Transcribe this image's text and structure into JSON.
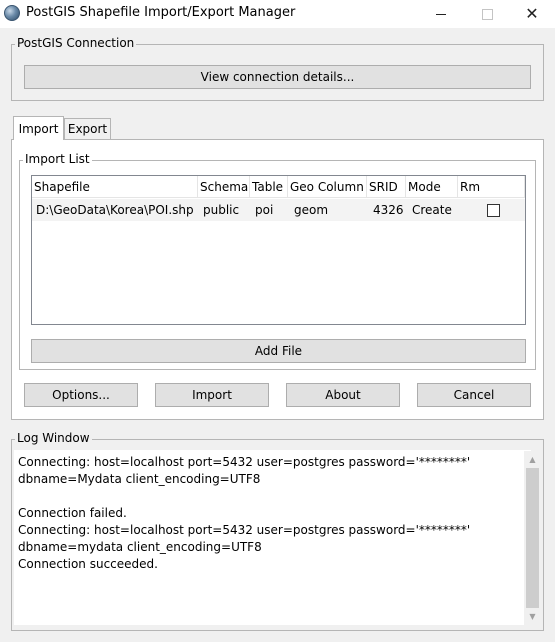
{
  "window": {
    "title": "PostGIS Shapefile Import/Export Manager",
    "minimize_glyph": "—",
    "close_glyph": "✕"
  },
  "connection": {
    "group_label": "PostGIS Connection",
    "view_button": "View connection details..."
  },
  "tabs": [
    {
      "label": "Import",
      "active": true
    },
    {
      "label": "Export",
      "active": false
    }
  ],
  "import_list": {
    "group_label": "Import List",
    "columns": [
      "Shapefile",
      "Schema",
      "Table",
      "Geo Column",
      "SRID",
      "Mode",
      "Rm"
    ],
    "rows": [
      {
        "shapefile": "D:\\GeoData\\Korea\\POI.shp",
        "schema": "public",
        "table": "poi",
        "geo_column": "geom",
        "srid": "4326",
        "mode": "Create",
        "rm_checked": false
      }
    ],
    "add_file_button": "Add File"
  },
  "actions": {
    "options": "Options...",
    "import": "Import",
    "about": "About",
    "cancel": "Cancel"
  },
  "log": {
    "group_label": "Log Window",
    "lines": [
      "Connecting:  host=localhost port=5432 user=postgres password='********'",
      "dbname=Mydata client_encoding=UTF8",
      "",
      "Connection failed.",
      "Connecting:  host=localhost port=5432 user=postgres password='********'",
      "dbname=mydata client_encoding=UTF8",
      "Connection succeeded."
    ]
  }
}
